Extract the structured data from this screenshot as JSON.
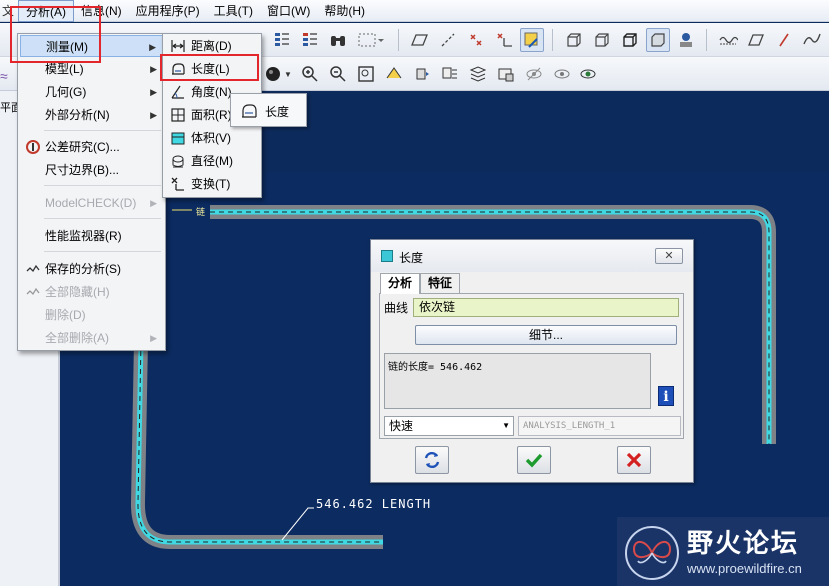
{
  "menubar": {
    "items": [
      {
        "label": "文"
      },
      {
        "label": "分析(A)"
      },
      {
        "label": "信息(N)"
      },
      {
        "label": "应用程序(P)"
      },
      {
        "label": "工具(T)"
      },
      {
        "label": "窗口(W)"
      },
      {
        "label": "帮助(H)"
      }
    ]
  },
  "left_panel": {
    "plane_label": "平面"
  },
  "analysis_menu": {
    "items": [
      {
        "label": "测量(M)",
        "icon": "none",
        "submenu": true,
        "highlighted": true
      },
      {
        "label": "模型(L)",
        "submenu": true
      },
      {
        "label": "几何(G)",
        "submenu": true
      },
      {
        "label": "外部分析(N)",
        "submenu": true
      },
      {
        "label": "公差研究(C)...",
        "icon": "tolerance-icon"
      },
      {
        "label": "尺寸边界(B)..."
      },
      {
        "label": "ModelCHECK(D)",
        "submenu": true,
        "disabled": true
      },
      {
        "label": "性能监视器(R)"
      },
      {
        "label": "保存的分析(S)",
        "icon": "saved-analysis-icon"
      },
      {
        "label": "全部隐藏(H)",
        "icon": "hide-all-icon",
        "disabled": true
      },
      {
        "label": "删除(D)",
        "disabled": true
      },
      {
        "label": "全部删除(A)",
        "submenu": true,
        "disabled": true
      }
    ]
  },
  "measure_submenu": {
    "items": [
      {
        "label": "距离(D)",
        "icon": "distance-icon"
      },
      {
        "label": "长度(L)",
        "icon": "length-icon",
        "highlighted": true
      },
      {
        "label": "角度(N)",
        "icon": "angle-icon"
      },
      {
        "label": "面积(R)",
        "icon": "area-icon"
      },
      {
        "label": "体积(V)",
        "icon": "volume-icon"
      },
      {
        "label": "直径(M)",
        "icon": "diameter-icon"
      },
      {
        "label": "变换(T)",
        "icon": "transform-icon"
      }
    ]
  },
  "tooltip": {
    "label": "长度"
  },
  "dialog": {
    "title": "长度",
    "tabs": [
      {
        "label": "分析",
        "active": true
      },
      {
        "label": "特征"
      }
    ],
    "curve_label": "曲线",
    "curve_value": "依次链",
    "detail_button": "细节...",
    "result_text": "链的长度= 546.462",
    "mode_value": "快速",
    "name_value": "ANALYSIS_LENGTH_1",
    "buttons": {
      "repeat": "repeat-icon",
      "ok": "check-icon",
      "cancel": "cancel-x-icon"
    }
  },
  "graphics": {
    "annotation": "546.462 LENGTH",
    "chain_label": "链",
    "curve_color": "#3fd8e3"
  },
  "watermark": {
    "title": "野火论坛",
    "url": "www.proewildfire.cn"
  },
  "colors": {
    "background": "#0c2b60",
    "highlight_box": "#e3262b",
    "field_green": "#e9f5c8"
  }
}
